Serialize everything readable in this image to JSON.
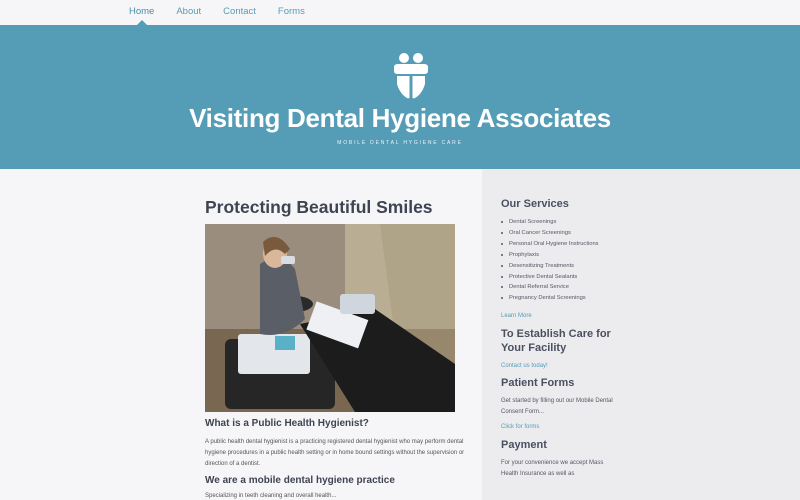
{
  "nav": {
    "items": [
      {
        "label": "Home",
        "active": true
      },
      {
        "label": "About",
        "active": false
      },
      {
        "label": "Contact",
        "active": false
      },
      {
        "label": "Forms",
        "active": false
      }
    ]
  },
  "hero": {
    "logo_icon": "tooth-logo-icon",
    "title": "Visiting Dental Hygiene Associates",
    "tagline": "MOBILE DENTAL HYGIENE CARE"
  },
  "main": {
    "heading": "Protecting Beautiful Smiles",
    "section1_title": "What is a Public Health Hygienist?",
    "section1_text": "A public health dental hygienist is a practicing registered dental hygienist who may perform dental hygiene procedures in a public health setting or in home bound settings without the supervision or direction of a dentist.",
    "section2_title": "We are a mobile dental hygiene practice",
    "section2_text": "Specializing in teeth cleaning and overall health..."
  },
  "sidebar": {
    "services_title": "Our Services",
    "services": [
      "Dental Screenings",
      "Oral Cancer Screenings",
      "Personal Oral Hygiene Instructions",
      "Prophylaxis",
      "Desensitizing Treatments",
      "Protective Dental Sealants",
      "Dental Referral Service",
      "Pregnancy Dental Screenings"
    ],
    "learn_more": "Learn More",
    "establish_title": "To Establish Care for Your Facility",
    "contact_link": "Contact us today!",
    "forms_title": "Patient Forms",
    "forms_text": "Get started by filling out our Mobile Dental Consent Form...",
    "forms_link": "Click for forms",
    "payment_title": "Payment",
    "payment_text": "For your convenience we accept Mass Health Insurance as well as"
  },
  "colors": {
    "banner": "#559db6",
    "link": "#559db6",
    "sidebar_bg": "#ececee"
  }
}
